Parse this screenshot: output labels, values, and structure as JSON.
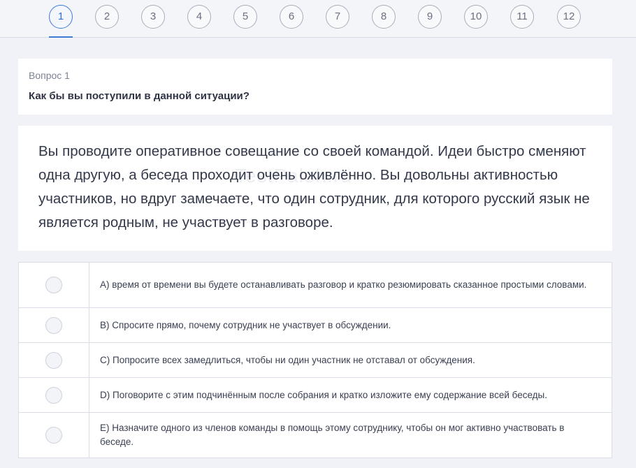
{
  "steps": [
    "1",
    "2",
    "3",
    "4",
    "5",
    "6",
    "7",
    "8",
    "9",
    "10",
    "11",
    "12"
  ],
  "active_step": "1",
  "question": {
    "number_label": "Вопрос 1",
    "title": "Как бы вы поступили в данной ситуации?"
  },
  "scenario": {
    "text": "Вы проводите оперативное совещание со своей командой. Идеи быстро сменяют одна другую, а беседа проходит очень оживлённо. Вы довольны активностью участников, но вдруг замечаете, что один сотрудник, для которого русский язык не является родным, не участвует в разговоре.",
    "watermark": "TestPaloh.ru"
  },
  "answers": [
    {
      "text": "A) время от времени вы будете останавливать разговор и кратко резюмировать сказанное простыми словами."
    },
    {
      "text": "B) Спросите прямо, почему сотрудник не участвует в обсуждении."
    },
    {
      "text": "C) Попросите всех замедлиться, чтобы ни один участник не отставал от обсуждения."
    },
    {
      "text": "D) Поговорите с этим подчинённым после собрания и кратко изложите ему содержание всей беседы."
    },
    {
      "text": "E) Назначите одного из членов команды в помощь этому сотруднику, чтобы он мог активно участвовать в беседе."
    }
  ],
  "colors": {
    "accent": "#3f7ad3",
    "background": "#f0f2f7",
    "card": "#ffffff"
  }
}
